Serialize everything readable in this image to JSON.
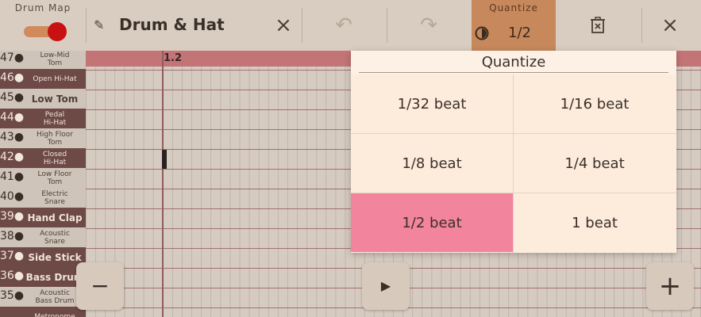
{
  "top_bar": {
    "drum_map_label": "Drum Map",
    "drum_map_enabled": true,
    "title": "Drum & Hat",
    "close_title_icon": "×",
    "undo_icon": "↶",
    "redo_icon": "↷",
    "quantize_label": "Quantize",
    "quantize_value": "1/2",
    "delete_icon": "🗑",
    "close_icon": "×"
  },
  "notes": [
    {
      "num": "47●",
      "name": "Low-Mid\nTom",
      "style": "light",
      "big": false
    },
    {
      "num": "46●",
      "name": "Open Hi-Hat",
      "style": "dark",
      "big": false
    },
    {
      "num": "45●",
      "name": "Low Tom",
      "style": "light",
      "big": true
    },
    {
      "num": "44●",
      "name": "Pedal\nHi-Hat",
      "style": "dark",
      "big": false
    },
    {
      "num": "43●",
      "name": "High Floor\nTom",
      "style": "light",
      "big": false
    },
    {
      "num": "42●",
      "name": "Closed\nHi-Hat",
      "style": "dark",
      "big": false
    },
    {
      "num": "41●",
      "name": "Low Floor\nTom",
      "style": "light",
      "big": false
    },
    {
      "num": "40●",
      "name": "Electric\nSnare",
      "style": "light",
      "big": false
    },
    {
      "num": "39●",
      "name": "Hand Clap",
      "style": "dark",
      "big": true
    },
    {
      "num": "38●",
      "name": "Acoustic\nSnare",
      "style": "light",
      "big": false
    },
    {
      "num": "37●",
      "name": "Side Stick",
      "style": "dark",
      "big": true
    },
    {
      "num": "36●",
      "name": "Bass Drum",
      "style": "dark",
      "big": true
    },
    {
      "num": "35●",
      "name": "Acoustic\nBass Drum",
      "style": "light",
      "big": false
    },
    {
      "num": "",
      "name": "Metronome",
      "style": "dark",
      "big": false
    }
  ],
  "grid": {
    "measure_label": "1.2"
  },
  "controls": {
    "minus": "−",
    "play": "▶",
    "plus": "+"
  },
  "quantize_popup": {
    "title": "Quantize",
    "options": [
      "1/32 beat",
      "1/16 beat",
      "1/8 beat",
      "1/4 beat",
      "1/2 beat",
      "1 beat"
    ],
    "selected": "1/2 beat"
  },
  "colors": {
    "accent": "#c7885c",
    "selected": "#f3849e",
    "ruler": "#c37476",
    "toggle_knob": "#c81212"
  }
}
